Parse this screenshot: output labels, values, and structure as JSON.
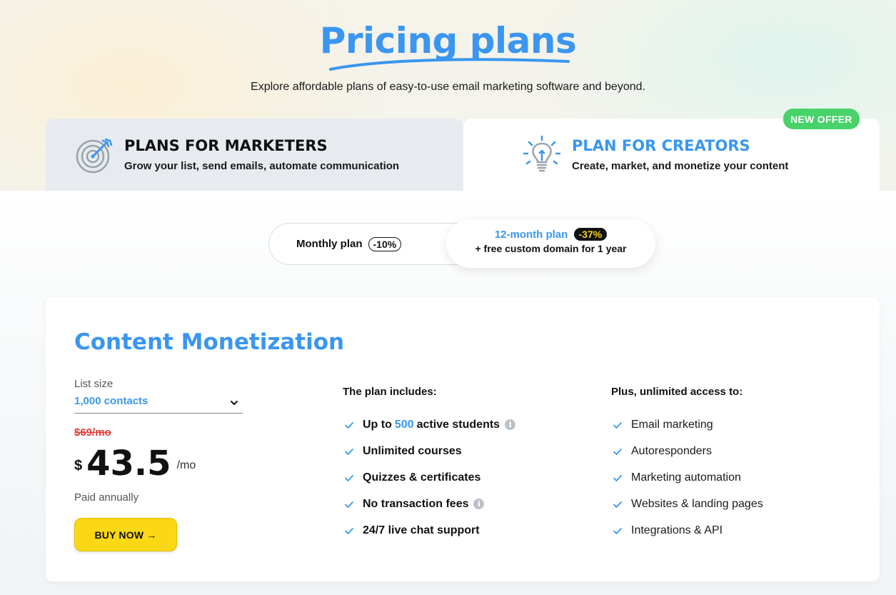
{
  "hero": {
    "title": "Pricing plans",
    "subtitle": "Explore affordable plans of easy-to-use email marketing software and beyond."
  },
  "tabs": [
    {
      "title": "PLANS FOR MARKETERS",
      "desc": "Grow your list, send emails, automate communication",
      "icon": "target-icon",
      "active": false
    },
    {
      "title": "PLAN FOR CREATORS",
      "desc": "Create, market, and monetize your content",
      "icon": "lightbulb-icon",
      "active": true
    }
  ],
  "new_offer_badge": "NEW OFFER",
  "billing": {
    "monthly_label": "Monthly plan",
    "monthly_discount": "-10%",
    "annual_label": "12-month plan",
    "annual_discount": "-37%",
    "annual_extra": "+ free custom domain for 1 year",
    "selected": "annual"
  },
  "plan": {
    "name": "Content Monetization",
    "list_size_label": "List size",
    "list_size_value": "1,000 contacts",
    "old_price": "$69/mo",
    "currency": "$",
    "price": "43.5",
    "per": "/mo",
    "billing_note": "Paid annually",
    "buy_label": "BUY NOW →"
  },
  "includes": {
    "heading": "The plan includes:",
    "items": [
      {
        "pre": "Up to",
        "highlight": "500",
        "post": "active students",
        "info": true
      },
      {
        "text": "Unlimited courses"
      },
      {
        "text": "Quizzes & certificates"
      },
      {
        "text": "No transaction fees",
        "info": true
      },
      {
        "text": "24/7 live chat support"
      }
    ]
  },
  "unlimited": {
    "heading": "Plus, unlimited access to:",
    "items": [
      "Email marketing",
      "Autoresponders",
      "Marketing automation",
      "Websites & landing pages",
      "Integrations & API"
    ]
  },
  "colors": {
    "brand_blue": "#3a96f0",
    "buy_yellow": "#fbd815",
    "new_badge_green": "#47d36a",
    "strike_red": "#e53935"
  }
}
